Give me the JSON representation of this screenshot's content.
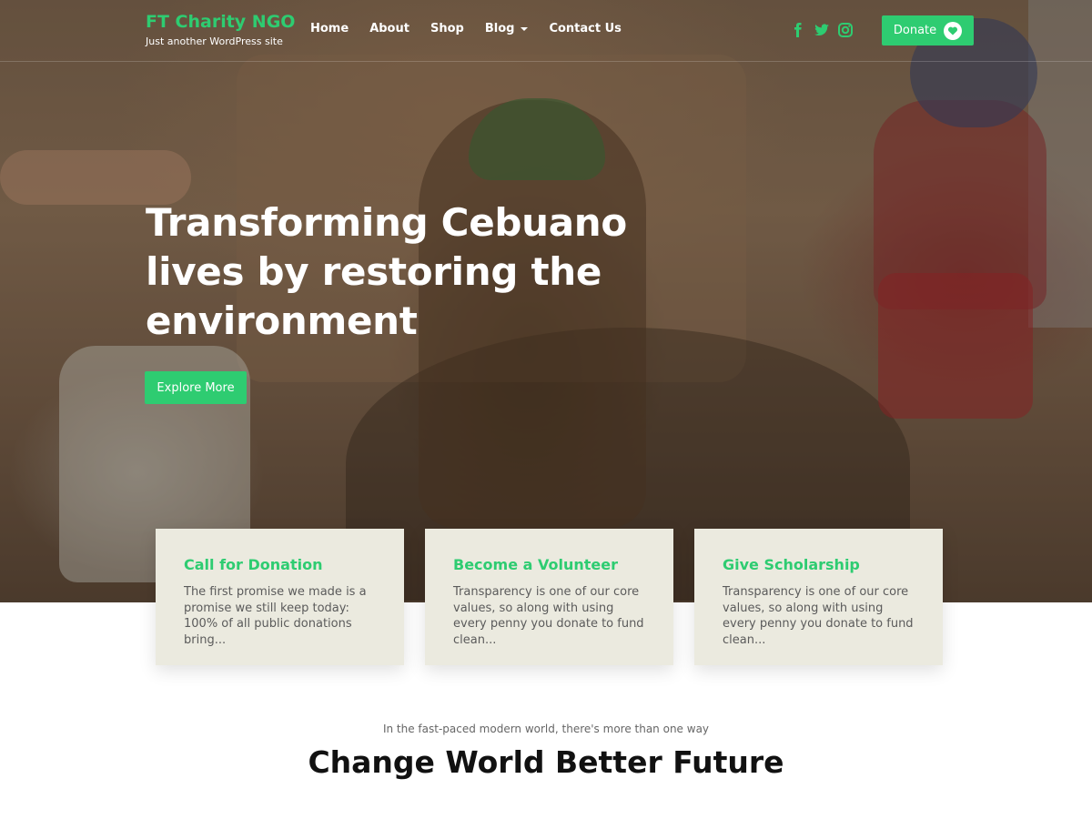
{
  "brand": {
    "title": "FT Charity NGO",
    "tagline": "Just another WordPress site",
    "accent_color": "#2ecc71"
  },
  "nav": {
    "items": [
      {
        "label": "Home"
      },
      {
        "label": "About"
      },
      {
        "label": "Shop"
      },
      {
        "label": "Blog",
        "has_dropdown": true
      },
      {
        "label": "Contact Us"
      }
    ]
  },
  "social": [
    "facebook-icon",
    "twitter-icon",
    "instagram-icon"
  ],
  "header": {
    "donate_label": "Donate"
  },
  "hero": {
    "title": "Transforming Cebuano lives by restoring the environment",
    "button_label": "Explore More"
  },
  "cards": [
    {
      "title": "Call for Donation",
      "text": "The first promise we made is a promise we still keep today: 100% of all public donations bring..."
    },
    {
      "title": "Become a Volunteer",
      "text": "Transparency is one of our core values, so along with using every penny you donate to fund clean..."
    },
    {
      "title": "Give Scholarship",
      "text": "Transparency is one of our core values, so along with using every penny you donate to fund clean..."
    }
  ],
  "section": {
    "subtitle": "In the fast-paced modern world, there's more than one way",
    "title": "Change World Better Future"
  }
}
